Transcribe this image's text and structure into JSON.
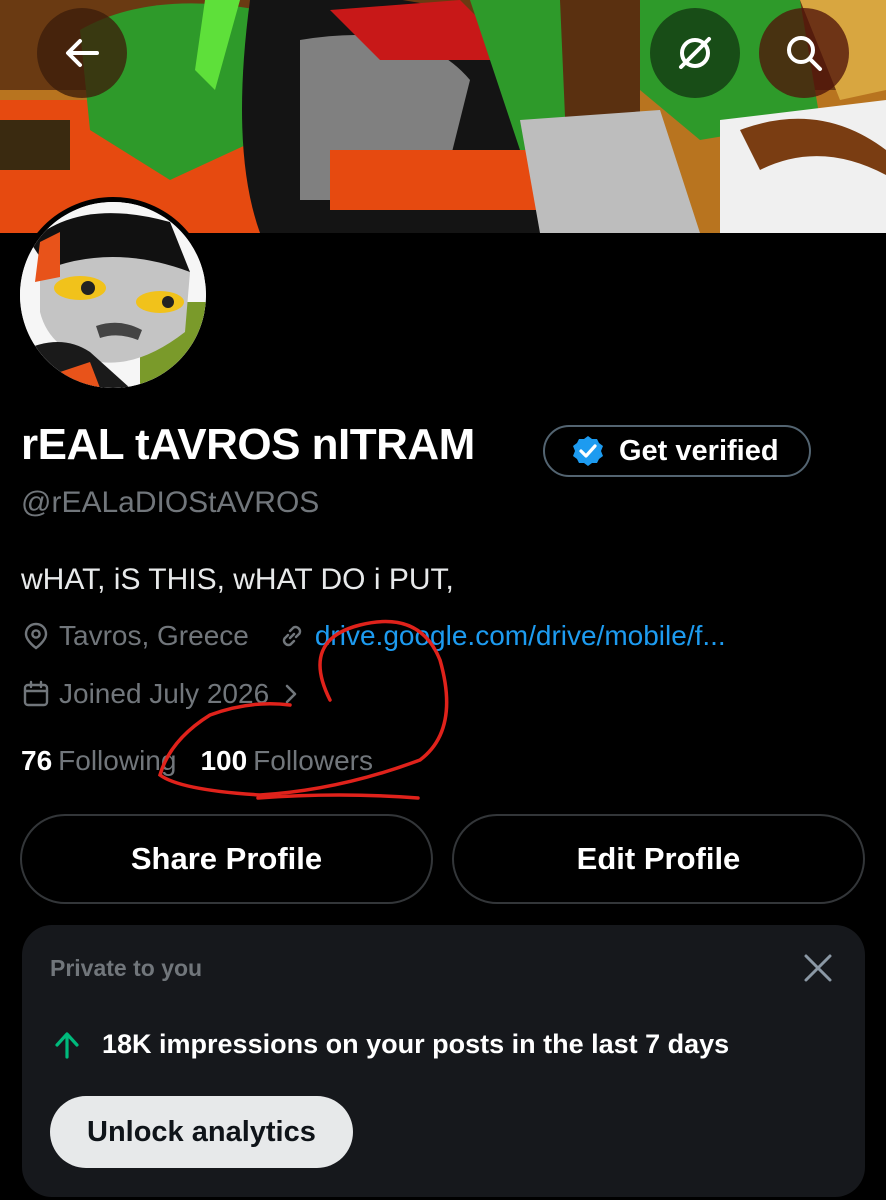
{
  "header": {
    "back_icon": "arrow-left-icon",
    "grok_icon": "grok-icon",
    "search_icon": "search-icon"
  },
  "profile": {
    "display_name": "rEAL tAVROS nITRAM",
    "verify_label": "Get verified",
    "handle": "@rEALaDIOStAVROS",
    "bio": "wHAT, iS THIS, wHAT DO i PUT,",
    "location": "Tavros, Greece",
    "link": "drive.google.com/drive/mobile/f...",
    "joined": "Joined July 2026",
    "following_count": "76",
    "following_label": "Following",
    "followers_count": "100",
    "followers_label": "Followers"
  },
  "actions": {
    "share_label": "Share Profile",
    "edit_label": "Edit Profile"
  },
  "private_card": {
    "label": "Private to you",
    "impressions_text": "18K impressions on your posts in the last 7 days",
    "unlock_label": "Unlock analytics"
  },
  "colors": {
    "accent_link": "#1d9bf0",
    "verified_badge": "#1d9bf0",
    "trend_up": "#00ba7c",
    "annotation": "#e0221b"
  }
}
